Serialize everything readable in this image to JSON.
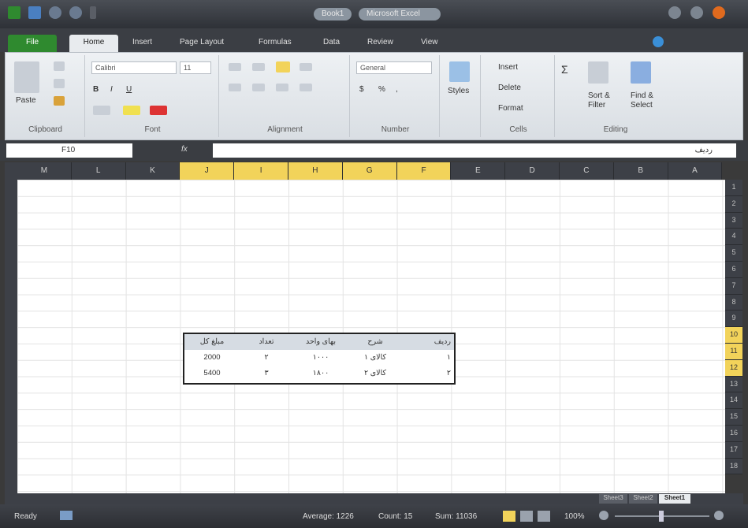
{
  "window": {
    "app_title_pill_1": "Book1",
    "app_title_pill_2": "Microsoft Excel"
  },
  "tabs": [
    "File",
    "Home",
    "Insert",
    "Page Layout",
    "Formulas",
    "Data",
    "Review",
    "View"
  ],
  "ribbon": {
    "clipboard": {
      "paste": "Paste",
      "label": "Clipboard"
    },
    "font": {
      "name": "Calibri",
      "size": "11",
      "label": "Font"
    },
    "alignment": {
      "label": "Alignment"
    },
    "number": {
      "format": "General",
      "label": "Number"
    },
    "styles": {
      "label": "Styles"
    },
    "cells": {
      "insert": "Insert",
      "delete": "Delete",
      "format": "Format",
      "label": "Cells"
    },
    "editing": {
      "sort": "Sort &",
      "filter": "Filter",
      "find": "Find &",
      "select": "Select",
      "label": "Editing"
    }
  },
  "formula_bar": {
    "name_box": "F10",
    "fx": "fx",
    "content": "ردیف"
  },
  "columns": [
    "M",
    "L",
    "K",
    "J",
    "I",
    "H",
    "G",
    "F",
    "E",
    "D",
    "C",
    "B",
    "A"
  ],
  "selected_columns": [
    "J",
    "I",
    "H",
    "G",
    "F"
  ],
  "rows": [
    "1",
    "2",
    "3",
    "4",
    "5",
    "6",
    "7",
    "8",
    "9",
    "10",
    "11",
    "12",
    "13",
    "14",
    "15",
    "16",
    "17",
    "18"
  ],
  "selected_rows": [
    "10",
    "11",
    "12"
  ],
  "table": {
    "headers": [
      "مبلغ کل",
      "تعداد",
      "بهای واحد",
      "شرح",
      "ردیف"
    ],
    "rows": [
      [
        "2000",
        "۲",
        "۱۰۰۰",
        "کالای ۱",
        "۱"
      ],
      [
        "5400",
        "۳",
        "۱۸۰۰",
        "کالای ۲",
        "۲"
      ]
    ]
  },
  "sheets": [
    "Sheet3",
    "Sheet2",
    "Sheet1"
  ],
  "status": {
    "ready": "Ready",
    "average": "Average: 1226",
    "count": "Count: 15",
    "sum": "Sum: 11036",
    "zoom": "100%"
  },
  "colors": {
    "accent": "#f2d35a",
    "file_tab": "#2f8a2f",
    "dark": "#3d4047"
  }
}
